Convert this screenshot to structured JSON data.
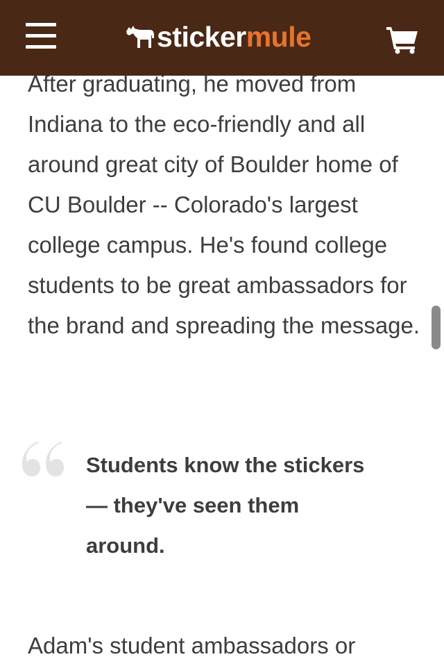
{
  "header": {
    "logo_word_1": "sticker",
    "logo_word_2": "mule",
    "menu_icon": "hamburger-menu-icon",
    "cart_icon": "shopping-cart-icon",
    "colors": {
      "header_bg": "#4a2816",
      "brand_orange": "#e8742a"
    }
  },
  "article": {
    "paragraph_1": "After graduating, he moved from Indiana to the eco-friendly and all around great city of Boulder home of CU Boulder -- Colorado's largest college campus. He's found college students to be great ambassadors for the brand and spreading the message.",
    "quote": "Students know the stickers — they've seen them around.",
    "paragraph_2": "Adam's student ambassadors or"
  }
}
